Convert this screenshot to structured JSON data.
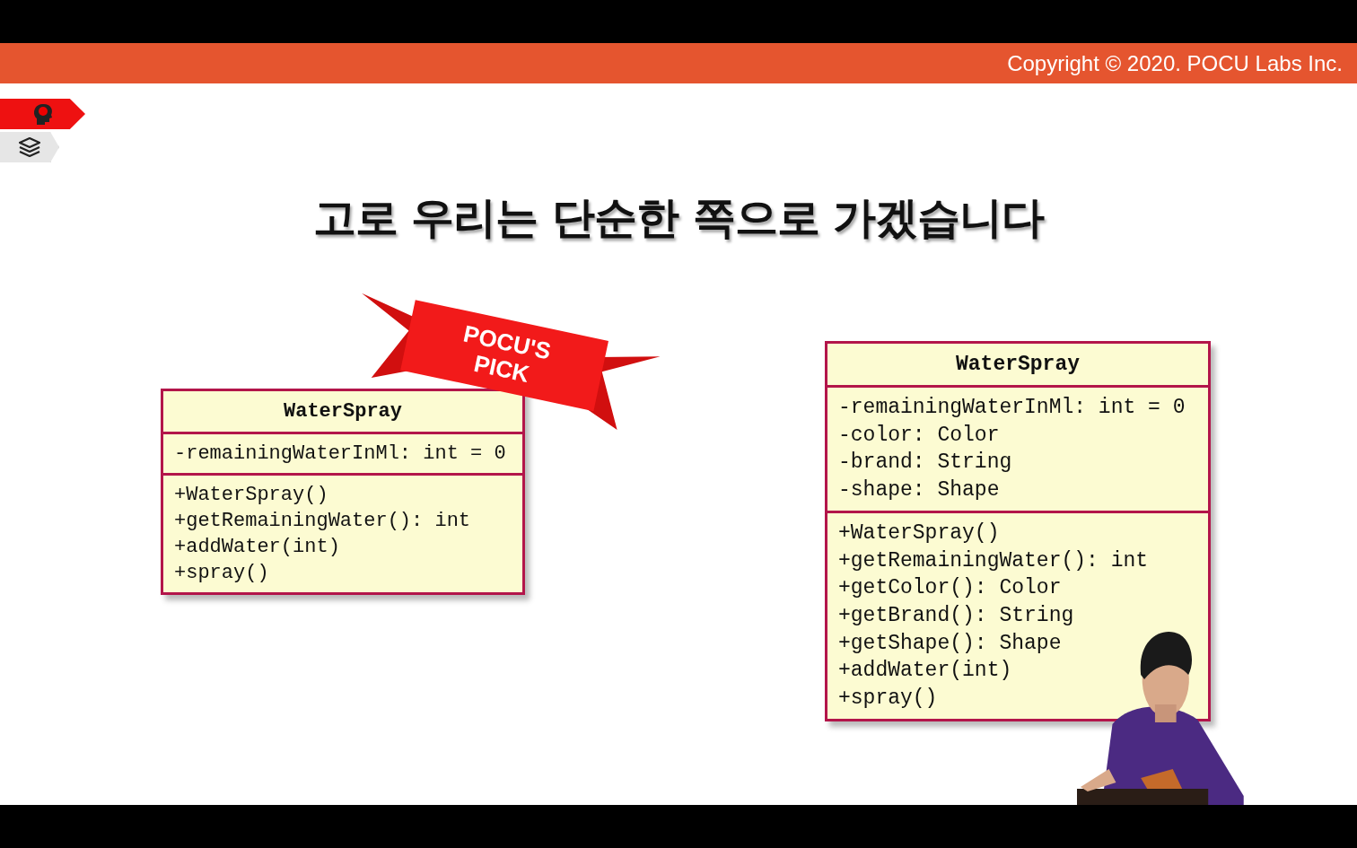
{
  "header": {
    "copyright": "Copyright © 2020. POCU Labs Inc."
  },
  "side_tabs": [
    {
      "kind": "brain",
      "selected": true
    },
    {
      "kind": "books",
      "selected": false
    }
  ],
  "slide": {
    "title": "고로 우리는 단순한 쪽으로 가겠습니다",
    "ribbon": {
      "lines": [
        "POCU'S",
        "PICK"
      ]
    },
    "classes": [
      {
        "name": "WaterSpray",
        "attributes": [
          "-remainingWaterInMl: int = 0"
        ],
        "methods": [
          "+WaterSpray()",
          "+getRemainingWater(): int",
          "+addWater(int)",
          "+spray()"
        ]
      },
      {
        "name": "WaterSpray",
        "attributes": [
          "-remainingWaterInMl: int = 0",
          "-color: Color",
          "-brand: String",
          "-shape: Shape"
        ],
        "methods": [
          "+WaterSpray()",
          "+getRemainingWater(): int",
          "+getColor(): Color",
          "+getBrand(): String",
          "+getShape(): Shape",
          "+addWater(int)",
          "+spray()"
        ]
      }
    ]
  }
}
